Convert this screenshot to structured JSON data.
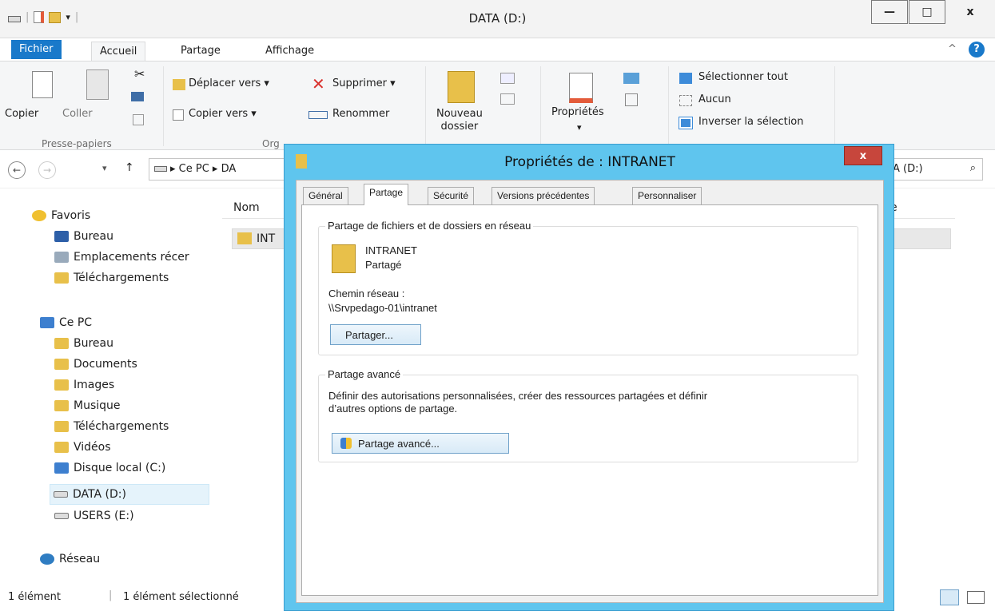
{
  "window": {
    "title": "DATA (D:)",
    "minimize": "—",
    "maximize": "□",
    "close": "x"
  },
  "ribbon": {
    "tabs": [
      "Fichier",
      "Accueil",
      "Partage",
      "Affichage"
    ],
    "collapse": "^",
    "help": "?",
    "clipboard": {
      "copy": "Copier",
      "paste": "Coller",
      "group": "Presse-papiers"
    },
    "organize": {
      "move": "Déplacer vers ▾",
      "copyto": "Copier vers ▾",
      "delete": "Supprimer ▾",
      "rename": "Renommer",
      "group": "Org"
    },
    "new": {
      "folder1": "Nouveau",
      "folder2": "dossier"
    },
    "open": {
      "props": "Propriétés",
      "arrow": "▾"
    },
    "select": {
      "all": "Sélectionner tout",
      "none": "Aucun",
      "invert": "Inverser la sélection"
    }
  },
  "address": {
    "back": "←",
    "fwd": "→",
    "dropdown": "▾",
    "up": "↑",
    "path": "▸ Ce PC ▸ DA",
    "search": "A (D:)",
    "search_icon": "⌕"
  },
  "nav": {
    "favorites": "Favoris",
    "fav_items": [
      "Bureau",
      "Emplacements récer",
      "Téléchargements"
    ],
    "pc": "Ce PC",
    "pc_items": [
      "Bureau",
      "Documents",
      "Images",
      "Musique",
      "Téléchargements",
      "Vidéos",
      "Disque local (C:)",
      "DATA (D:)",
      "USERS (E:)"
    ],
    "network": "Réseau"
  },
  "content": {
    "col_name": "Nom",
    "col_e": "e",
    "row_name": "INT"
  },
  "status": {
    "count": "1 élément",
    "selected": "1 élément sélectionné"
  },
  "dialog": {
    "title": "Propriétés de : INTRANET",
    "close": "x",
    "tabs": [
      "Général",
      "Partage",
      "Sécurité",
      "Versions précédentes",
      "Personnaliser"
    ],
    "net_share": {
      "legend": "Partage de fichiers et de dossiers en réseau",
      "name": "INTRANET",
      "state": "Partagé",
      "path_label": "Chemin réseau :",
      "path": "\\\\Srvpedago-01\\intranet",
      "button": "Partager..."
    },
    "adv_share": {
      "legend": "Partage avancé",
      "desc1": "Définir des autorisations personnalisées, créer des ressources partagées et définir",
      "desc2": "d’autres options de partage.",
      "button": "Partage avancé..."
    }
  },
  "colors": {
    "accent": "#1979ca",
    "dialog_frame": "#5fc5ee",
    "close_red": "#c7463c",
    "folder": "#e8c04a"
  }
}
